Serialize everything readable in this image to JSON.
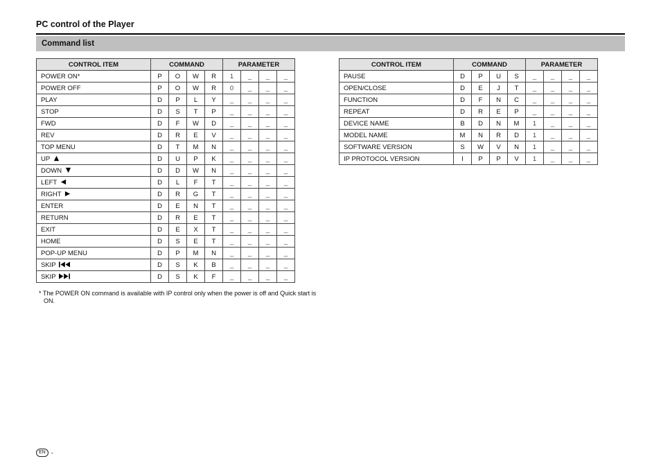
{
  "title": "PC control of the Player",
  "subhead": "Command list",
  "headers": {
    "control": "CONTROL ITEM",
    "command": "COMMAND",
    "parameter": "PARAMETER"
  },
  "dash": "_",
  "leftTable": [
    {
      "label": "POWER ON*",
      "icon": null,
      "cmd": [
        "P",
        "O",
        "W",
        "R"
      ],
      "param": [
        "1",
        "_",
        "_",
        "_"
      ]
    },
    {
      "label": "POWER OFF",
      "icon": null,
      "cmd": [
        "P",
        "O",
        "W",
        "R"
      ],
      "param": [
        "0",
        "_",
        "_",
        "_"
      ]
    },
    {
      "label": "PLAY",
      "icon": null,
      "cmd": [
        "D",
        "P",
        "L",
        "Y"
      ],
      "param": [
        "_",
        "_",
        "_",
        "_"
      ]
    },
    {
      "label": "STOP",
      "icon": null,
      "cmd": [
        "D",
        "S",
        "T",
        "P"
      ],
      "param": [
        "_",
        "_",
        "_",
        "_"
      ]
    },
    {
      "label": "FWD",
      "icon": null,
      "cmd": [
        "D",
        "F",
        "W",
        "D"
      ],
      "param": [
        "_",
        "_",
        "_",
        "_"
      ]
    },
    {
      "label": "REV",
      "icon": null,
      "cmd": [
        "D",
        "R",
        "E",
        "V"
      ],
      "param": [
        "_",
        "_",
        "_",
        "_"
      ]
    },
    {
      "label": "TOP MENU",
      "icon": null,
      "cmd": [
        "D",
        "T",
        "M",
        "N"
      ],
      "param": [
        "_",
        "_",
        "_",
        "_"
      ]
    },
    {
      "label": "UP",
      "icon": "up",
      "cmd": [
        "D",
        "U",
        "P",
        "K"
      ],
      "param": [
        "_",
        "_",
        "_",
        "_"
      ]
    },
    {
      "label": "DOWN",
      "icon": "down",
      "cmd": [
        "D",
        "D",
        "W",
        "N"
      ],
      "param": [
        "_",
        "_",
        "_",
        "_"
      ]
    },
    {
      "label": "LEFT",
      "icon": "left",
      "cmd": [
        "D",
        "L",
        "F",
        "T"
      ],
      "param": [
        "_",
        "_",
        "_",
        "_"
      ]
    },
    {
      "label": "RIGHT",
      "icon": "right",
      "cmd": [
        "D",
        "R",
        "G",
        "T"
      ],
      "param": [
        "_",
        "_",
        "_",
        "_"
      ]
    },
    {
      "label": "ENTER",
      "icon": null,
      "cmd": [
        "D",
        "E",
        "N",
        "T"
      ],
      "param": [
        "_",
        "_",
        "_",
        "_"
      ]
    },
    {
      "label": "RETURN",
      "icon": null,
      "cmd": [
        "D",
        "R",
        "E",
        "T"
      ],
      "param": [
        "_",
        "_",
        "_",
        "_"
      ]
    },
    {
      "label": "EXIT",
      "icon": null,
      "cmd": [
        "D",
        "E",
        "X",
        "T"
      ],
      "param": [
        "_",
        "_",
        "_",
        "_"
      ]
    },
    {
      "label": "HOME",
      "icon": null,
      "cmd": [
        "D",
        "S",
        "E",
        "T"
      ],
      "param": [
        "_",
        "_",
        "_",
        "_"
      ]
    },
    {
      "label": "POP-UP MENU",
      "icon": null,
      "cmd": [
        "D",
        "P",
        "M",
        "N"
      ],
      "param": [
        "_",
        "_",
        "_",
        "_"
      ]
    },
    {
      "label": "SKIP",
      "icon": "skip-back",
      "cmd": [
        "D",
        "S",
        "K",
        "B"
      ],
      "param": [
        "_",
        "_",
        "_",
        "_"
      ]
    },
    {
      "label": "SKIP",
      "icon": "skip-fwd",
      "cmd": [
        "D",
        "S",
        "K",
        "F"
      ],
      "param": [
        "_",
        "_",
        "_",
        "_"
      ]
    }
  ],
  "rightTable": [
    {
      "label": "PAUSE",
      "icon": null,
      "cmd": [
        "D",
        "P",
        "U",
        "S"
      ],
      "param": [
        "_",
        "_",
        "_",
        "_"
      ]
    },
    {
      "label": "OPEN/CLOSE",
      "icon": null,
      "cmd": [
        "D",
        "E",
        "J",
        "T"
      ],
      "param": [
        "_",
        "_",
        "_",
        "_"
      ]
    },
    {
      "label": "FUNCTION",
      "icon": null,
      "cmd": [
        "D",
        "F",
        "N",
        "C"
      ],
      "param": [
        "_",
        "_",
        "_",
        "_"
      ]
    },
    {
      "label": "REPEAT",
      "icon": null,
      "cmd": [
        "D",
        "R",
        "E",
        "P"
      ],
      "param": [
        "_",
        "_",
        "_",
        "_"
      ]
    },
    {
      "label": "DEVICE NAME",
      "icon": null,
      "cmd": [
        "B",
        "D",
        "N",
        "M"
      ],
      "param": [
        "1",
        "_",
        "_",
        "_"
      ]
    },
    {
      "label": "MODEL NAME",
      "icon": null,
      "cmd": [
        "M",
        "N",
        "R",
        "D"
      ],
      "param": [
        "1",
        "_",
        "_",
        "_"
      ]
    },
    {
      "label": "SOFTWARE VERSION",
      "icon": null,
      "cmd": [
        "S",
        "W",
        "V",
        "N"
      ],
      "param": [
        "1",
        "_",
        "_",
        "_"
      ]
    },
    {
      "label": "IP PROTOCOL VERSION",
      "icon": null,
      "cmd": [
        "I",
        "P",
        "P",
        "V"
      ],
      "param": [
        "1",
        "_",
        "_",
        "_"
      ]
    }
  ],
  "footnote": "* The POWER ON command is available with IP control only when the power is off and Quick start is ON.",
  "footer": {
    "lang": "EN",
    "page": "-"
  }
}
